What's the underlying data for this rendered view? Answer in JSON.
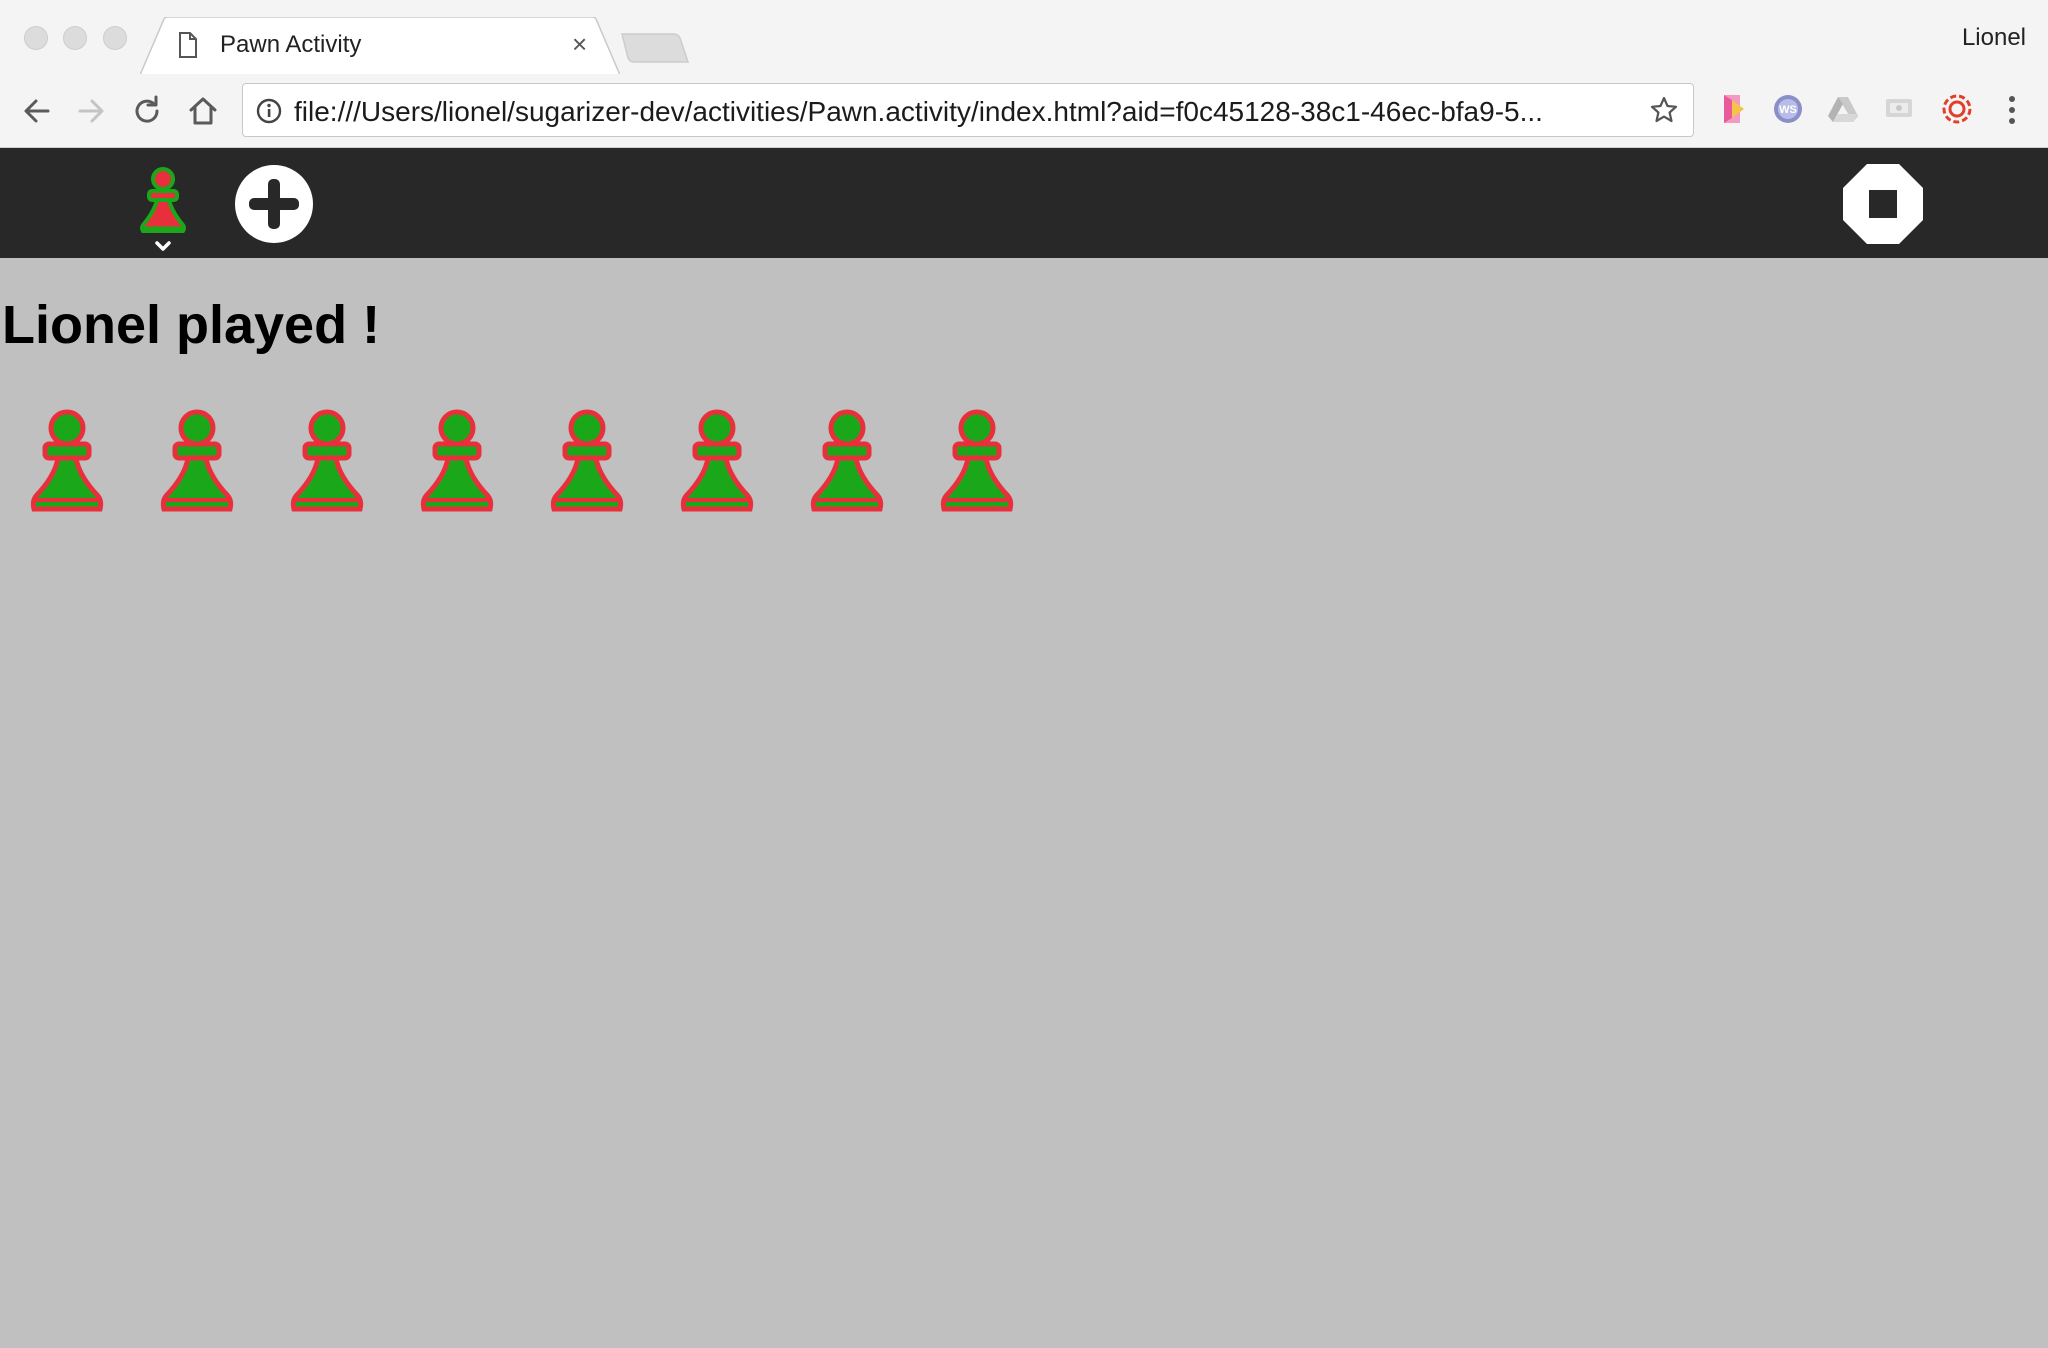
{
  "browser": {
    "tab_title": "Pawn Activity",
    "tab_close": "×",
    "profile_name": "Lionel",
    "url": "file:///Users/lionel/sugarizer-dev/activities/Pawn.activity/index.html?aid=f0c45128-38c1-46ec-bfa9-5...",
    "extensions": [
      "extension-1-icon",
      "extension-ws-icon",
      "google-drive-icon",
      "cast-icon",
      "extension-spiral-icon"
    ]
  },
  "app": {
    "status_message": "Lionel played !",
    "pawn_count": 8,
    "pawn_colors": {
      "fill": "#1aa81a",
      "stroke": "#e8303c"
    },
    "toolbar_colors": {
      "background": "#282828"
    }
  }
}
